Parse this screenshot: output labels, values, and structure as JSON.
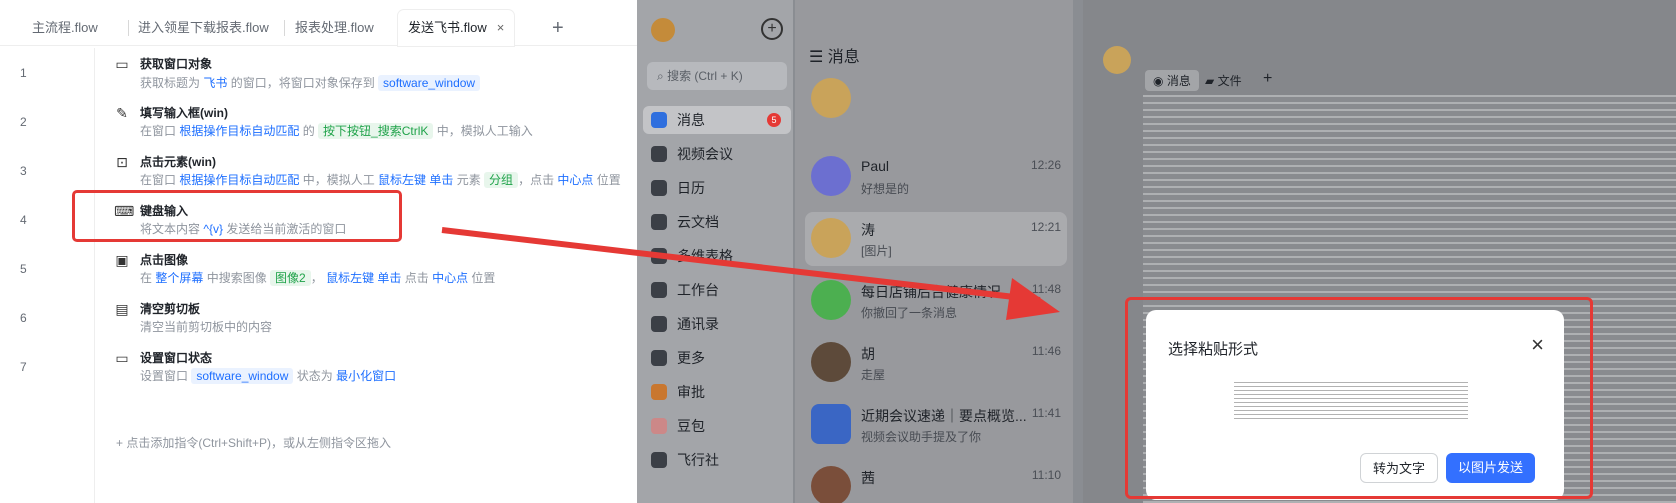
{
  "editor": {
    "tabs": [
      {
        "label": "主流程.flow"
      },
      {
        "label": "进入领星下载报表.flow"
      },
      {
        "label": "报表处理.flow"
      },
      {
        "label": "发送飞书.flow",
        "close": "×"
      }
    ],
    "add_tab": "+",
    "steps": [
      {
        "num": "1",
        "title": "获取窗口对象",
        "desc_a": "获取标题为 ",
        "desc_b": "飞书",
        "desc_c": " 的窗口，将窗口对象保存到 ",
        "desc_d": "software_window"
      },
      {
        "num": "2",
        "title": "填写输入框(win)",
        "desc_a": "在窗口 ",
        "desc_b": "根据操作目标自动匹配",
        "desc_c": " 的 ",
        "desc_d": "按下按钮_搜索CtrlK",
        "desc_e": " 中，模拟人工输入"
      },
      {
        "num": "3",
        "title": "点击元素(win)",
        "desc_a": "在窗口 ",
        "desc_b": "根据操作目标自动匹配",
        "desc_c": " 中，模拟人工 ",
        "desc_d": "鼠标左键 单击",
        "desc_e": " 元素 ",
        "desc_f": "分组",
        "desc_g": "，点击 ",
        "desc_h": "中心点",
        "desc_i": " 位置"
      },
      {
        "num": "4",
        "title": "键盘输入",
        "desc_a": "将文本内容 ",
        "desc_b": "^{v}",
        "desc_c": " 发送给当前激活的窗口"
      },
      {
        "num": "5",
        "title": "点击图像",
        "desc_a": "在 ",
        "desc_b": "整个屏幕",
        "desc_c": " 中搜索图像 ",
        "desc_d": "图像2",
        "desc_e": "， ",
        "desc_f": "鼠标左键 单击",
        "desc_g": " 点击 ",
        "desc_h": "中心点",
        "desc_i": " 位置"
      },
      {
        "num": "6",
        "title": "清空剪切板",
        "desc_a": "清空当前剪切板中的内容"
      },
      {
        "num": "7",
        "title": "设置窗口状态",
        "desc_a": "设置窗口 ",
        "desc_b": "software_window",
        "desc_c": " 状态为 ",
        "desc_d": "最小化窗口"
      }
    ],
    "add_hint": "+  点击添加指令(Ctrl+Shift+P)，或从左侧指令区拖入"
  },
  "feishu": {
    "search_placeholder": "搜索 (Ctrl + K)",
    "sidebar": [
      {
        "label": "消息",
        "badge": "5"
      },
      {
        "label": "视频会议"
      },
      {
        "label": "日历"
      },
      {
        "label": "云文档"
      },
      {
        "label": "多维表格"
      },
      {
        "label": "工作台"
      },
      {
        "label": "通讯录"
      },
      {
        "label": "更多"
      },
      {
        "label": "审批"
      },
      {
        "label": "豆包"
      },
      {
        "label": "飞行社"
      }
    ],
    "messages_header": "消息",
    "chats": [
      {
        "name": "Paul",
        "time": "12:26",
        "preview": "好想是的"
      },
      {
        "name": "涛",
        "time": "12:21",
        "preview": "[图片]"
      },
      {
        "name": "每日店铺后台健康情况",
        "time": "11:48",
        "preview": "你撤回了一条消息"
      },
      {
        "name": "胡",
        "time": "11:46",
        "preview": "走屋"
      },
      {
        "name": "近期会议速递｜要点概览...",
        "time": "11:41",
        "preview": "视频会议助手提及了你"
      },
      {
        "name": "茜",
        "time": "11:10",
        "preview": ""
      }
    ],
    "chat_tabs": {
      "messages": "消息",
      "files": "文件",
      "add": "+"
    },
    "dialog": {
      "title": "选择粘贴形式",
      "close": "×",
      "btn_text": "转为文字",
      "btn_image": "以图片发送"
    }
  }
}
